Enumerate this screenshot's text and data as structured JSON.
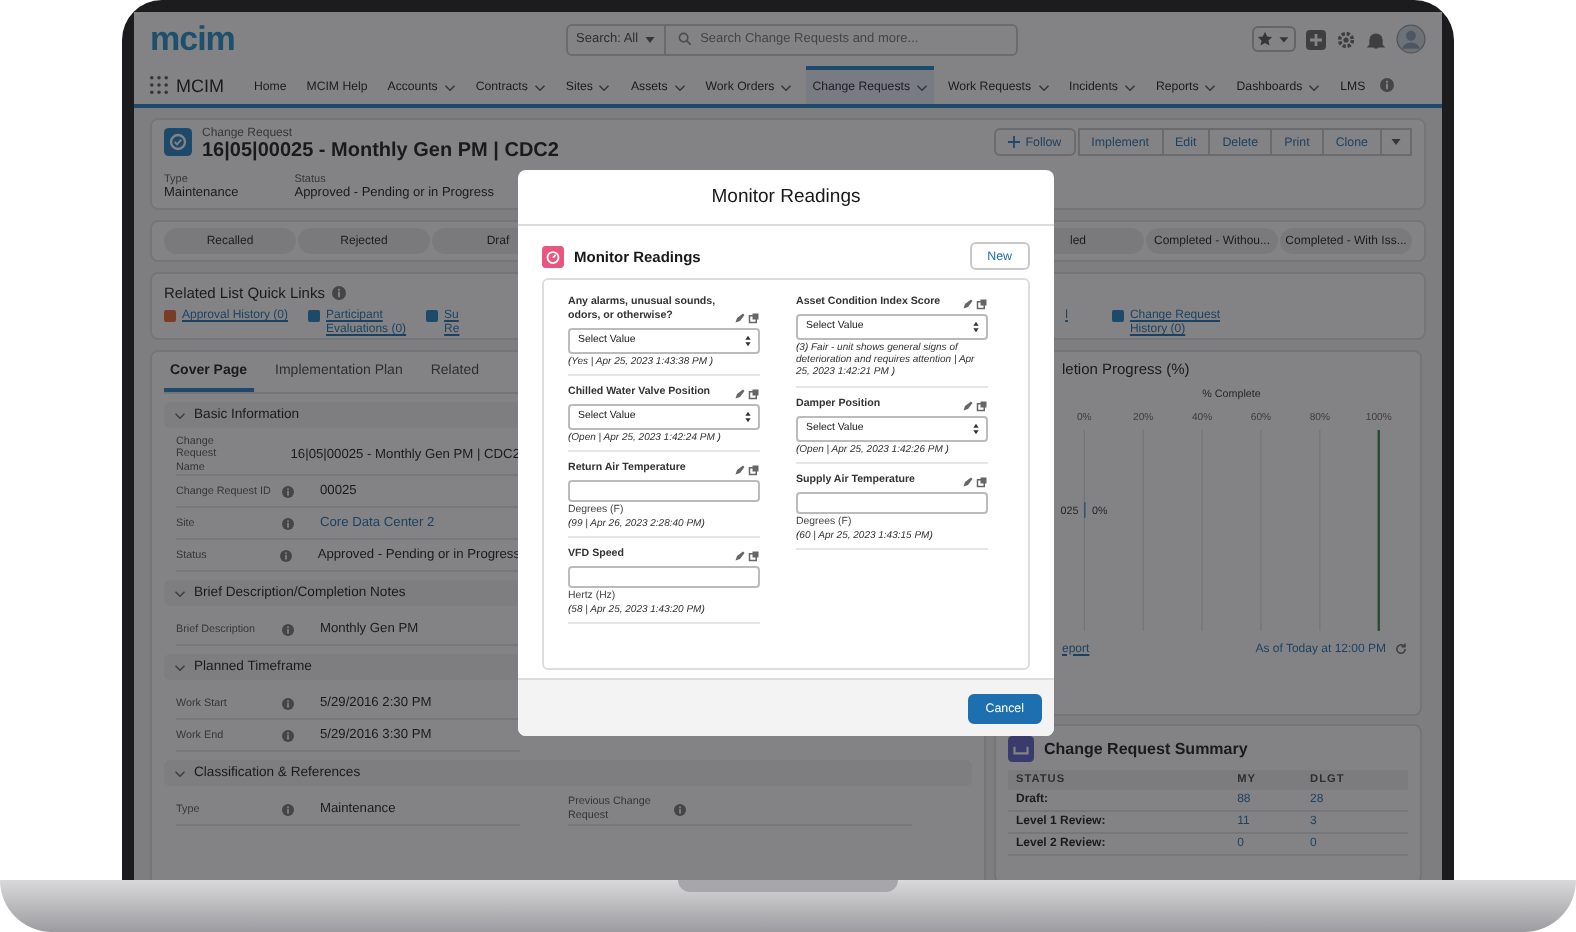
{
  "header": {
    "logo": "mcim",
    "search_scope": "Search: All",
    "search_placeholder": "Search Change Requests and more..."
  },
  "nav": {
    "app_name": "MCIM",
    "items": [
      {
        "label": "Home",
        "dropdown": false,
        "selected": false
      },
      {
        "label": "MCIM Help",
        "dropdown": false,
        "selected": false
      },
      {
        "label": "Accounts",
        "dropdown": true,
        "selected": false
      },
      {
        "label": "Contracts",
        "dropdown": true,
        "selected": false
      },
      {
        "label": "Sites",
        "dropdown": true,
        "selected": false
      },
      {
        "label": "Assets",
        "dropdown": true,
        "selected": false
      },
      {
        "label": "Work Orders",
        "dropdown": true,
        "selected": false
      },
      {
        "label": "Change Requests",
        "dropdown": true,
        "selected": true
      },
      {
        "label": "Work Requests",
        "dropdown": true,
        "selected": false
      },
      {
        "label": "Incidents",
        "dropdown": true,
        "selected": false
      },
      {
        "label": "Reports",
        "dropdown": true,
        "selected": false
      },
      {
        "label": "Dashboards",
        "dropdown": true,
        "selected": false
      },
      {
        "label": "LMS",
        "dropdown": false,
        "selected": false
      }
    ]
  },
  "record": {
    "object": "Change Request",
    "title": "16|05|00025 - Monthly Gen PM | CDC2",
    "follow": "Follow",
    "actions": [
      "Implement",
      "Edit",
      "Delete",
      "Print",
      "Clone"
    ],
    "fields": [
      {
        "label": "Type",
        "value": "Maintenance"
      },
      {
        "label": "Status",
        "value": "Approved - Pending or in Progress"
      }
    ]
  },
  "path": {
    "left": [
      "Recalled",
      "Rejected",
      "Draf"
    ],
    "right": [
      "led",
      "Completed - Withou...",
      "Completed - With Iss..."
    ]
  },
  "quick_links": {
    "title": "Related List Quick Links",
    "left": [
      {
        "lines": [
          "Approval History (0)"
        ],
        "kind": "approval"
      },
      {
        "lines": [
          "Participant",
          "Evaluations (0)"
        ],
        "kind": "record"
      },
      {
        "lines": [
          "Su",
          "Re"
        ],
        "kind": "record"
      }
    ],
    "right": [
      {
        "lines": [
          "l"
        ],
        "kind": "plain"
      },
      {
        "lines": [
          "Change Request",
          "History (0)"
        ],
        "kind": "record"
      }
    ]
  },
  "details": {
    "tabs": [
      {
        "label": "Cover Page",
        "selected": true
      },
      {
        "label": "Implementation Plan",
        "selected": false
      },
      {
        "label": "Related",
        "selected": false
      }
    ],
    "sections": [
      {
        "title": "Basic Information",
        "expanded": true,
        "fields": [
          {
            "label": "Change Request Name",
            "value": "16|05|00025 - Monthly Gen PM | CDC2",
            "info": false,
            "link": false
          },
          {
            "label": "Change Request ID",
            "value": "00025",
            "info": true,
            "link": false
          },
          {
            "label": "Site",
            "value": "Core Data Center 2",
            "info": true,
            "link": true
          },
          {
            "label": "Status",
            "value": "Approved - Pending or in Progress",
            "info": true,
            "link": false
          }
        ]
      },
      {
        "title": "Brief Description/Completion Notes",
        "expanded": true,
        "fields": [
          {
            "label": "Brief Description",
            "value": "Monthly Gen PM",
            "info": true,
            "link": false
          }
        ]
      },
      {
        "title": "Planned Timeframe",
        "expanded": true,
        "fields": [
          {
            "label": "Work Start",
            "value": "5/29/2016 2:30 PM",
            "info": true,
            "link": false
          },
          {
            "label": "Work End",
            "value": "5/29/2016 3:30 PM",
            "info": true,
            "link": false
          }
        ]
      },
      {
        "title": "Classification & References",
        "expanded": true,
        "fields": [
          {
            "label": "Type",
            "value": "Maintenance",
            "info": true,
            "link": false
          },
          {
            "label": "Previous Change Request",
            "info": true,
            "link": false
          }
        ]
      }
    ]
  },
  "progress": {
    "link": "eport",
    "as_of": "As of Today at 12:00 PM",
    "chart_data": {
      "type": "bar",
      "orientation": "horizontal",
      "title": "letion Progress (%)",
      "xlabel": "% Complete",
      "categories": [
        "025"
      ],
      "values": [
        0
      ],
      "xlim": [
        0,
        100
      ],
      "xticks": [
        {
          "value": 0,
          "label": "0%"
        },
        {
          "value": 20,
          "label": "20%"
        },
        {
          "value": 40,
          "label": "40%"
        },
        {
          "value": 60,
          "label": "60%"
        },
        {
          "value": 80,
          "label": "80%"
        },
        {
          "value": 100,
          "label": "100%"
        }
      ],
      "value_labels": [
        "0%"
      ],
      "grid": true
    }
  },
  "summary": {
    "title": "Change Request Summary",
    "columns": [
      "STATUS",
      "MY",
      "DLGT"
    ],
    "rows": [
      [
        "Draft:",
        "88",
        "28"
      ],
      [
        "Level 1 Review:",
        "11",
        "3"
      ],
      [
        "Level 2 Review:",
        "0",
        "0"
      ]
    ]
  },
  "modal": {
    "title": "Monitor Readings",
    "card_title": "Monitor Readings",
    "new_button": "New",
    "cancel_button": "Cancel",
    "columns": [
      [
        {
          "kind": "picklist",
          "label": "Any alarms, unusual sounds, odors, or otherwise?",
          "value": "Select Value",
          "note": "(Yes | Apr 25, 2023 1:43:38 PM )"
        },
        {
          "kind": "picklist",
          "label": "Chilled Water Valve Position",
          "value": "Select Value",
          "note": "(Open | Apr 25, 2023 1:42:24 PM )"
        },
        {
          "kind": "number",
          "label": "Return Air Temperature",
          "unit": "Degrees (F)",
          "note": "(99 | Apr 26, 2023 2:28:40 PM)"
        },
        {
          "kind": "number",
          "label": "VFD Speed",
          "unit": "Hertz (Hz)",
          "note": "(58 | Apr 25, 2023 1:43:20 PM)"
        }
      ],
      [
        {
          "kind": "picklist",
          "label": "Asset Condition Index Score",
          "value": "Select Value",
          "note": "(3) Fair - unit shows general signs of deterioration and requires attention | Apr 25, 2023 1:42:21 PM )"
        },
        {
          "kind": "picklist",
          "label": "Damper Position",
          "value": "Select Value",
          "note": "(Open | Apr 25, 2023 1:42:26 PM )"
        },
        {
          "kind": "number",
          "label": "Supply Air Temperature",
          "unit": "Degrees (F)",
          "note": "(60 | Apr 25, 2023 1:43:15 PM)"
        }
      ]
    ]
  }
}
